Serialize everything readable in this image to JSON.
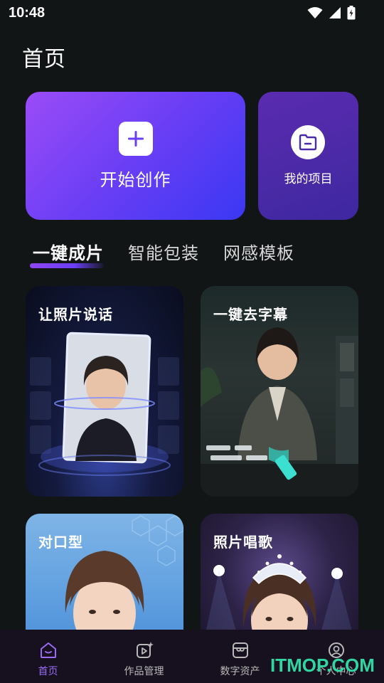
{
  "status_bar": {
    "time": "10:48"
  },
  "page_title": "首页",
  "hero": {
    "create_label": "开始创作",
    "project_label": "我的项目"
  },
  "tabs": [
    {
      "label": "一键成片",
      "active": true
    },
    {
      "label": "智能包装",
      "active": false
    },
    {
      "label": "网感模板",
      "active": false
    }
  ],
  "features": [
    {
      "title": "让照片说话"
    },
    {
      "title": "一键去字幕"
    },
    {
      "title": "对口型"
    },
    {
      "title": "照片唱歌"
    }
  ],
  "bottom_nav": [
    {
      "label": "首页",
      "icon": "home-icon",
      "active": true
    },
    {
      "label": "作品管理",
      "icon": "video-sparkle-icon",
      "active": false
    },
    {
      "label": "数字资产",
      "icon": "store-icon",
      "active": false
    },
    {
      "label": "个人中心",
      "icon": "user-circle-icon",
      "active": false
    }
  ],
  "watermark": "ITMOP.COM",
  "colors": {
    "accent": "#9a6cf5",
    "background": "#121516",
    "nav_bg": "#17101f"
  }
}
